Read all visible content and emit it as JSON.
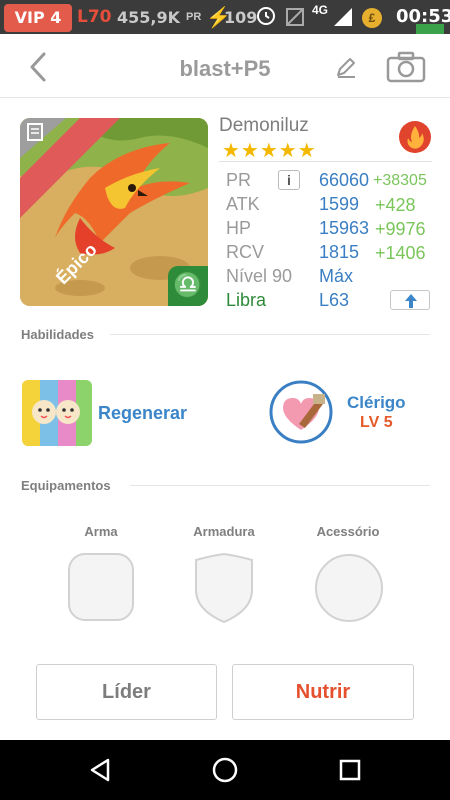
{
  "status_bar": {
    "vip": "VIP 4",
    "level": "L70",
    "power": "455,9K",
    "power_unit": "PR",
    "energy": "109",
    "network": "4G",
    "time": "00:53"
  },
  "header": {
    "title": "blast+P5"
  },
  "monster": {
    "rarity": "Épico",
    "name": "Demoniluz",
    "stars": "★★★★★",
    "stats": [
      {
        "label": "PR",
        "value": "66060",
        "bonus": "+38305"
      },
      {
        "label": "ATK",
        "value": "1599",
        "bonus": "+428"
      },
      {
        "label": "HP",
        "value": "15963",
        "bonus": "+9976"
      },
      {
        "label": "RCV",
        "value": "1815",
        "bonus": "+1406"
      },
      {
        "label": "Nível 90",
        "value": "Máx",
        "bonus": ""
      },
      {
        "label": "Libra",
        "value": "L63",
        "bonus": ""
      }
    ],
    "info_icon": "i"
  },
  "abilities": {
    "title": "Habilidades",
    "skill_name": "Regenerar",
    "leader_name": "Clérigo",
    "leader_level": "LV 5"
  },
  "equipment": {
    "title": "Equipamentos",
    "slots": [
      "Arma",
      "Armadura",
      "Acessório"
    ]
  },
  "buttons": {
    "leader": "Líder",
    "feed": "Nutrir"
  },
  "colors": {
    "accent_blue": "#3a86c8",
    "bonus_green": "#7ac65b",
    "feed_orange": "#e5512e",
    "libra_green": "#2e8b3a",
    "rarity_red": "#e05a5a"
  }
}
